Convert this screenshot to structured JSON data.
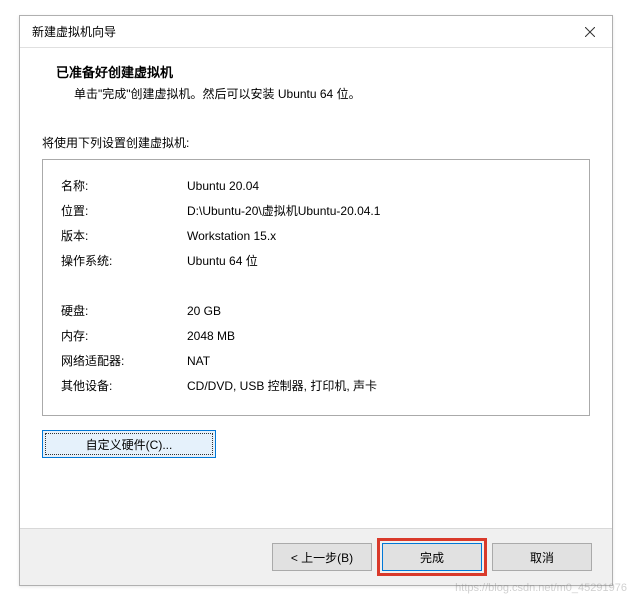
{
  "titlebar": {
    "title": "新建虚拟机向导"
  },
  "header": {
    "title": "已准备好创建虚拟机",
    "subtitle": "单击\"完成\"创建虚拟机。然后可以安装 Ubuntu 64 位。"
  },
  "settingsLabel": "将使用下列设置创建虚拟机:",
  "rows": {
    "name": {
      "label": "名称:",
      "value": "Ubuntu 20.04"
    },
    "location": {
      "label": "位置:",
      "value": "D:\\Ubuntu-20\\虚拟机Ubuntu-20.04.1"
    },
    "version": {
      "label": "版本:",
      "value": "Workstation 15.x"
    },
    "os": {
      "label": "操作系统:",
      "value": "Ubuntu 64 位"
    },
    "disk": {
      "label": "硬盘:",
      "value": "20 GB"
    },
    "memory": {
      "label": "内存:",
      "value": "2048 MB"
    },
    "network": {
      "label": "网络适配器:",
      "value": "NAT"
    },
    "other": {
      "label": "其他设备:",
      "value": "CD/DVD, USB 控制器, 打印机, 声卡"
    }
  },
  "buttons": {
    "customHardware": "自定义硬件(C)...",
    "back": "< 上一步(B)",
    "finish": "完成",
    "cancel": "取消"
  },
  "watermark": "https://blog.csdn.net/m0_45291976"
}
